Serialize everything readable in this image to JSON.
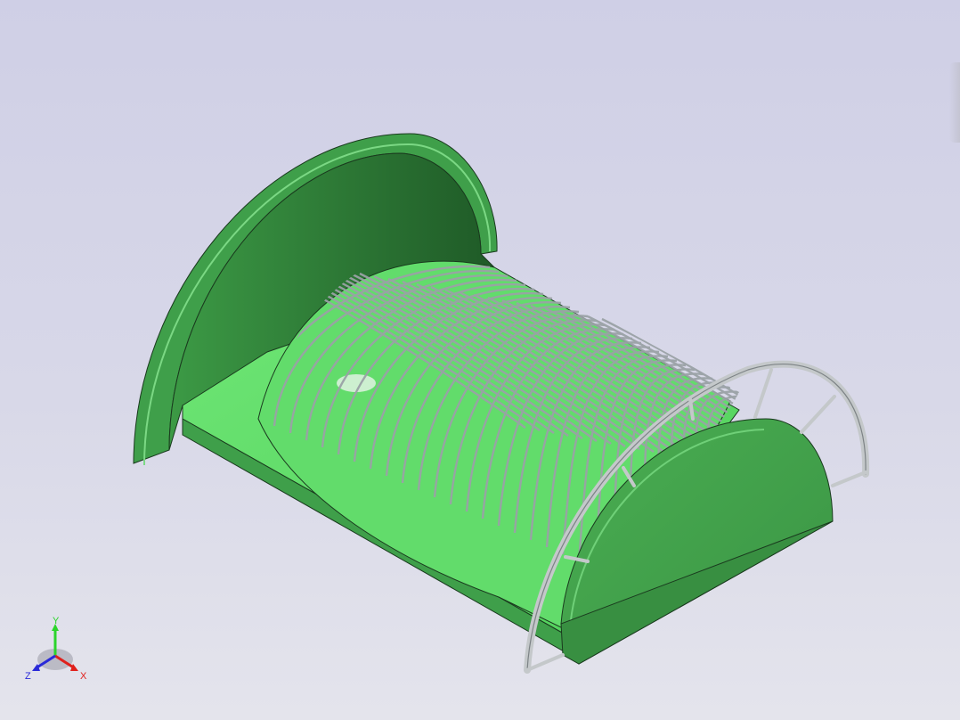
{
  "viewport": {
    "background_top": "#cfcfe6",
    "background_bottom": "#e4e4ec",
    "model_colors": {
      "body_green": "#3f9f4a",
      "body_green_light": "#54c25e",
      "body_green_dark": "#2b7a35",
      "inner_green": "#66e06e",
      "mesh_steel": "#a9b0b3",
      "frame_steel": "#c8cbcd"
    }
  },
  "axis_triad": {
    "labels": {
      "x": "X",
      "y": "Y",
      "z": "Z"
    },
    "colors": {
      "x": "#e0201c",
      "y": "#2bd42b",
      "z": "#2a2ad8"
    }
  },
  "icons": [
    "axis-triad-icon"
  ]
}
